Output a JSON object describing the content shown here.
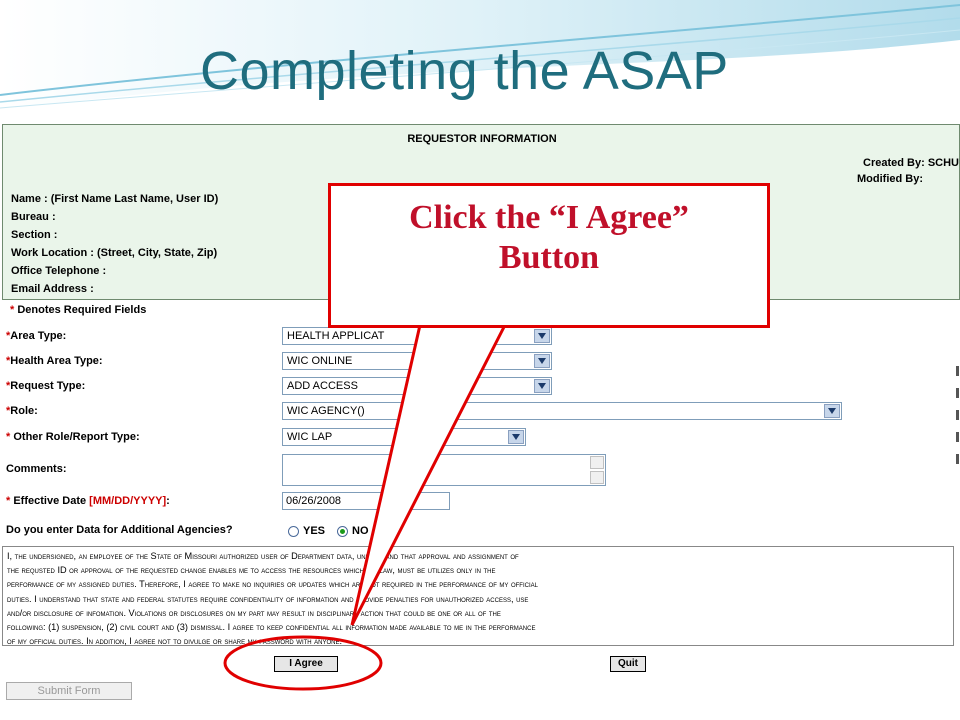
{
  "slide": {
    "title": "Completing the ASAP"
  },
  "requestor": {
    "heading": "REQUESTOR INFORMATION",
    "created_by": "Created By: SCHU",
    "modified_by": "Modified By:",
    "labels": [
      "Name : (First Name Last Name,  User ID)",
      "Bureau :",
      "Section :",
      "Work Location : (Street, City, State, Zip)",
      "Office Telephone :",
      "Email Address :"
    ]
  },
  "form": {
    "required_note": "Denotes Required Fields",
    "area_type": {
      "label": "Area Type:",
      "value": "HEALTH APPLICAT"
    },
    "health_area_type": {
      "label": "Health Area Type:",
      "value": "WIC ONLINE"
    },
    "request_type": {
      "label": "Request Type:",
      "value": "ADD ACCESS"
    },
    "role": {
      "label": "Role:",
      "value": "WIC AGENCY()"
    },
    "other_role": {
      "label": "Other Role/Report Type:",
      "value": "WIC LAP"
    },
    "comments": {
      "label": "Comments:"
    },
    "effective_date": {
      "label": "Effective Date ",
      "format": "[MM/DD/YYYY]",
      "suffix": ":",
      "value": "06/26/2008"
    },
    "additional_agencies": {
      "label": "Do you enter Data for Additional Agencies?",
      "yes": "YES",
      "no": "NO",
      "selected": "NO"
    }
  },
  "agreement": {
    "lines": [
      "I, the undersigned, an employee of the State of Missouri authorized user of Department data, understand that approval and assignment of",
      "the requsted ID or approval of the requested change enables me to access the resources which, by law, must be utilizes only in the",
      "performance of my assigned duties. Therefore, I agree to make no inquiries or updates which are not required in the performance of my official",
      "duties. I understand that state and federal statutes require confidentiality of information and provide penalties for unauthorized access, use",
      "and/or disclosure of infomation. Violations or disclosures on my part may result in disciplinary action that could be one or all of the",
      "following: (1) suspension, (2) civil court and (3) dismissal. I agree to keep confidential all information made available to me in the performance",
      "of my official duties. In addition, I agree not to divulge or share my password with anyone."
    ]
  },
  "buttons": {
    "agree": "I Agree",
    "quit": "Quit",
    "submit": "Submit  Form"
  },
  "callout": {
    "line1": "Click the “I Agree”",
    "line2": "Button",
    "color": "#e00000"
  },
  "colors": {
    "title": "#1f6d7e",
    "requestor_bg": "#eaf5ea",
    "required_star": "#cc0000",
    "callout_text": "#c0102a"
  }
}
